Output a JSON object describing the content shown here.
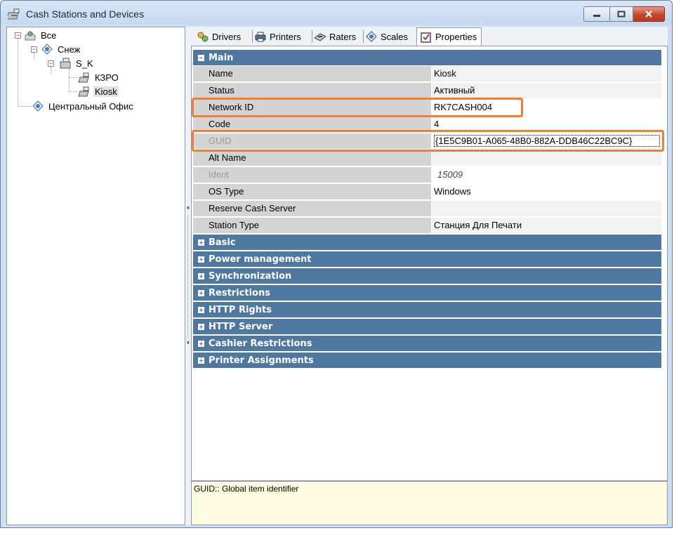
{
  "window": {
    "title": "Cash Stations and Devices"
  },
  "tree": {
    "root": "Все",
    "node1": "Снеж",
    "node2": "S_K",
    "leaf1": "КЗРО",
    "leaf2": "Kiosk",
    "node3": "Центральный Офис"
  },
  "tabs": [
    {
      "label": "Drivers",
      "icon": "drivers-icon"
    },
    {
      "label": "Printers",
      "icon": "printer-icon"
    },
    {
      "label": "Raters",
      "icon": "rater-icon"
    },
    {
      "label": "Scales",
      "icon": "scale-icon"
    },
    {
      "label": "Properties",
      "icon": "properties-icon"
    }
  ],
  "grid": {
    "main_category": "Main",
    "rows": [
      {
        "name": "Name",
        "value": "Kiosk"
      },
      {
        "name": "Status",
        "value": "Активный"
      },
      {
        "name": "Network ID",
        "value": "RK7CASH004"
      },
      {
        "name": "Code",
        "value": "4"
      },
      {
        "name": "GUID",
        "value": "{1E5C9B01-A065-48B0-882A-DDB46C22BC9C}"
      },
      {
        "name": "Alt Name",
        "value": ""
      },
      {
        "name": "Ident",
        "value": "15009"
      },
      {
        "name": "OS Type",
        "value": "Windows"
      },
      {
        "name": "Reserve Cash Server",
        "value": ""
      },
      {
        "name": "Station Type",
        "value": "Станция Для Печати"
      }
    ],
    "categories": [
      "Basic",
      "Power management",
      "Synchronization",
      "Restrictions",
      "HTTP Rights",
      "HTTP Server",
      "Cashier Restrictions",
      "Printer Assignments"
    ]
  },
  "description": "GUID:: Global item identifier",
  "colors": {
    "category": "#4e78a0",
    "highlight": "#f07f33",
    "description_bg": "#fefbe0"
  }
}
